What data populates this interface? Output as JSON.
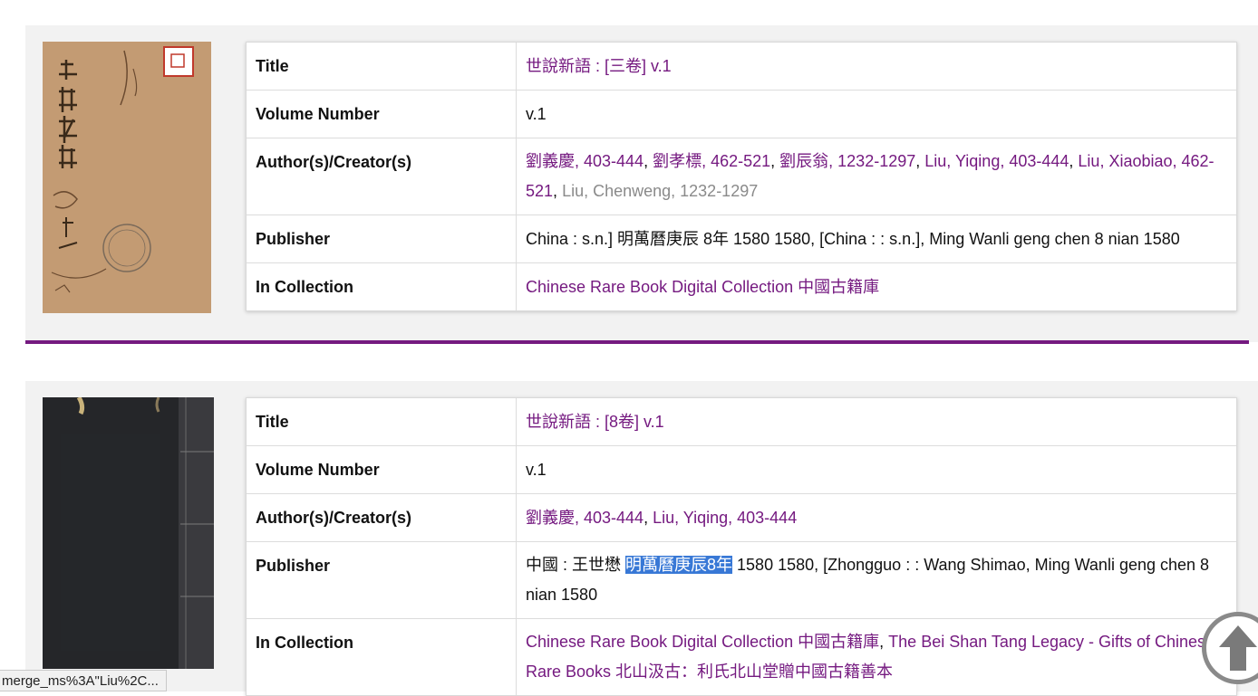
{
  "records": [
    {
      "thumbnail_icon": "book-cover-thumbnail",
      "title_label": "Title",
      "title_value": "世說新語 : [三卷] v.1",
      "volume_label": "Volume Number",
      "volume_value": "v.1",
      "author_label": "Author(s)/Creator(s)",
      "authors": [
        "劉義慶, 403-444",
        "劉孝標, 462-521",
        "劉辰翁, 1232-1297",
        "Liu, Yiqing, 403-444",
        "Liu, Xiaobiao, 462-521",
        "Liu, Chenweng, 1232-1297"
      ],
      "publisher_label": "Publisher",
      "publisher_value": "China : s.n.] 明萬曆庚辰 8年 1580 1580, [China : : s.n.], Ming Wanli geng chen 8 nian 1580",
      "collection_label": "In Collection",
      "collections": [
        "Chinese Rare Book Digital Collection 中國古籍庫"
      ]
    },
    {
      "thumbnail_icon": "book-cover-thumbnail",
      "title_label": "Title",
      "title_value": "世說新語 : [8卷] v.1",
      "volume_label": "Volume Number",
      "volume_value": "v.1",
      "author_label": "Author(s)/Creator(s)",
      "authors": [
        "劉義慶, 403-444",
        "Liu, Yiqing, 403-444"
      ],
      "publisher_label": "Publisher",
      "publisher_prefix": "中國 : 王世懋 ",
      "publisher_highlight": "明萬曆庚辰8年",
      "publisher_suffix": " 1580 1580, [Zhongguo : : Wang Shimao, Ming Wanli geng chen 8 nian 1580",
      "collection_label": "In Collection",
      "collections": [
        "Chinese Rare Book Digital Collection 中國古籍庫",
        "The Bei Shan Tang Legacy - Gifts of Chinese Rare Books 北山汲古：利氏北山堂贈中國古籍善本"
      ]
    }
  ],
  "sep": ", ",
  "status_url": "merge_ms%3A\"Liu%2C...",
  "scroll_top_icon": "arrow-up-icon",
  "colors": {
    "link": "#751a80",
    "divider": "#751a80",
    "highlight": "#3878d6"
  }
}
